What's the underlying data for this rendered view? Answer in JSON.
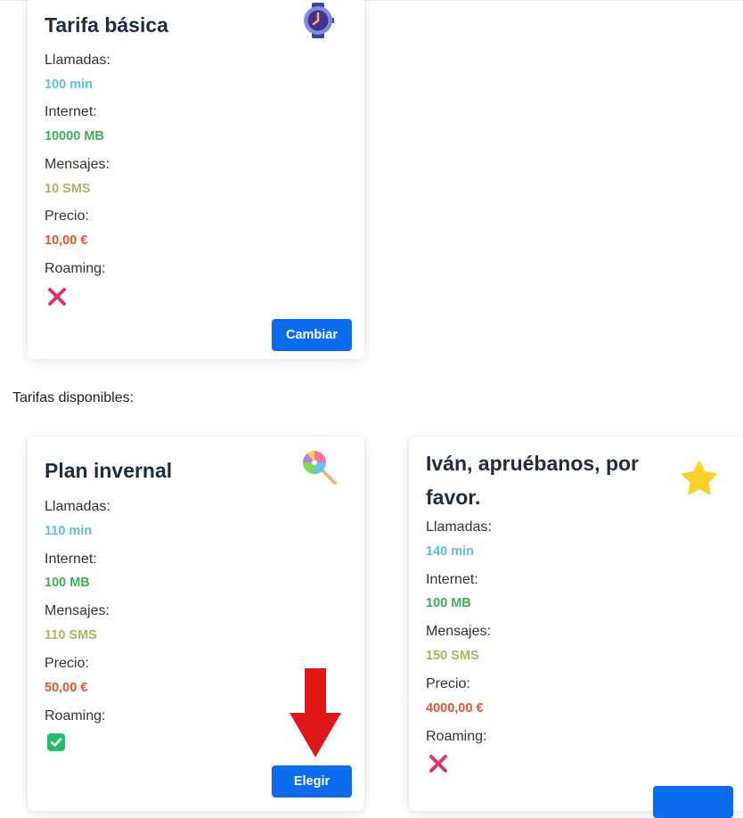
{
  "current_plan": {
    "name": "Tarifa básica",
    "icon": "watch-icon",
    "calls_label": "Llamadas:",
    "calls_value": "100 min",
    "internet_label": "Internet:",
    "internet_value": "10000 MB",
    "sms_label": "Mensajes:",
    "sms_value": "10 SMS",
    "price_label": "Precio:",
    "price_value": "10,00 €",
    "roaming_label": "Roaming:",
    "roaming": false,
    "button_label": "Cambiar"
  },
  "available_heading": "Tarifas disponibles:",
  "plans": [
    {
      "name": "Plan invernal",
      "icon": "lollipop-icon",
      "calls_label": "Llamadas:",
      "calls_value": "110 min",
      "internet_label": "Internet:",
      "internet_value": "100 MB",
      "sms_label": "Mensajes:",
      "sms_value": "110 SMS",
      "price_label": "Precio:",
      "price_value": "50,00 €",
      "roaming_label": "Roaming:",
      "roaming": true,
      "button_label": "Elegir"
    },
    {
      "name_line1": "Iván, apruébanos, por",
      "name_line2": "favor.",
      "icon": "star-icon",
      "calls_label": "Llamadas:",
      "calls_value": "140 min",
      "internet_label": "Internet:",
      "internet_value": "100 MB",
      "sms_label": "Mensajes:",
      "sms_value": "150 SMS",
      "price_label": "Precio:",
      "price_value": "4000,00 €",
      "roaming_label": "Roaming:",
      "roaming": false
    }
  ],
  "colors": {
    "calls": "#5bc0de",
    "data": "#3cb05a",
    "sms": "#a5b85c",
    "price": "#e8542b",
    "button": "#0b6cf0",
    "cross": "#e0336b",
    "check": "#1fbf6b",
    "arrow": "#e01818"
  }
}
